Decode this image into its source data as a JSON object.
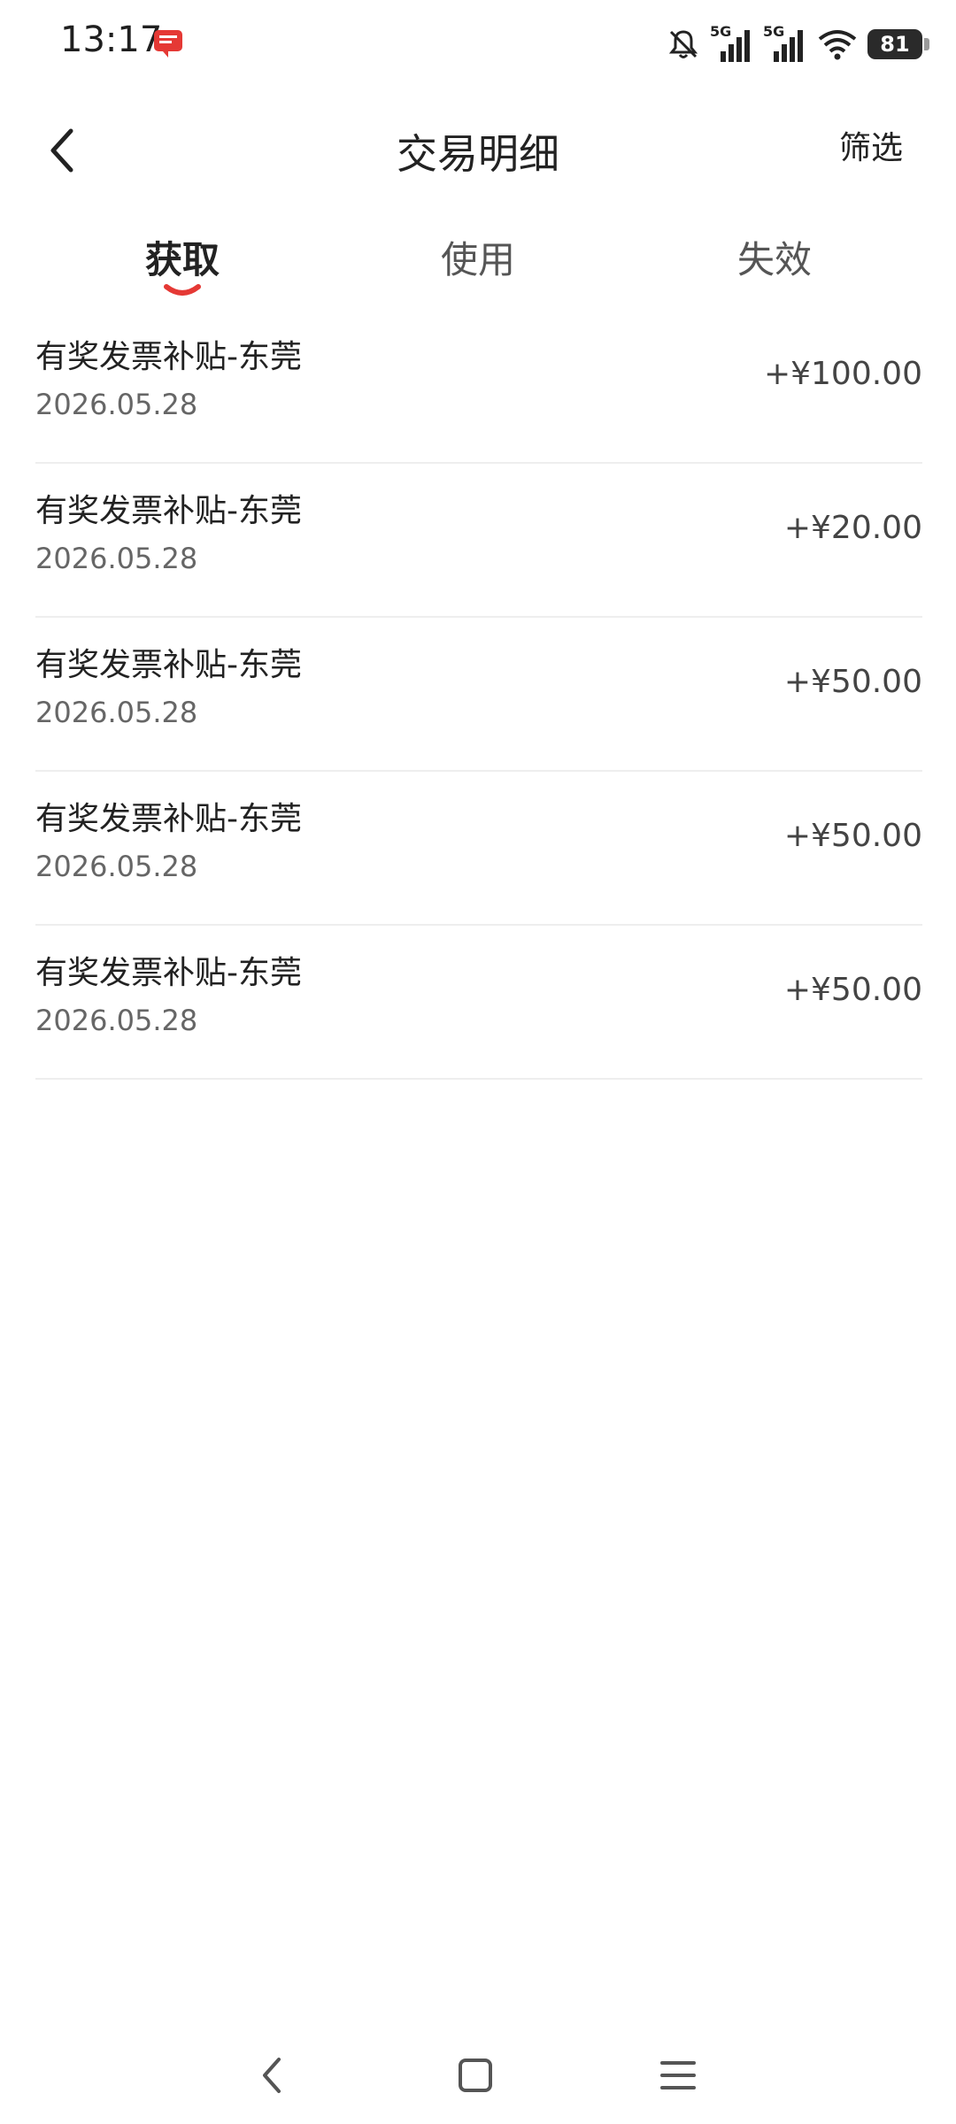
{
  "status_bar": {
    "time": "13:17",
    "network_1": "5G",
    "network_2": "5G",
    "battery_level": "81",
    "icons": [
      "notification-app-icon",
      "mute-icon",
      "signal-icon",
      "signal-icon",
      "wifi-icon",
      "battery-icon"
    ]
  },
  "header": {
    "title": "交易明细",
    "filter_label": "筛选",
    "back_icon": "chevron-left-icon"
  },
  "tabs": [
    {
      "label": "获取",
      "active": true
    },
    {
      "label": "使用",
      "active": false
    },
    {
      "label": "失效",
      "active": false
    }
  ],
  "accent_color": "#e53935",
  "transactions": [
    {
      "title": "有奖发票补贴-东莞",
      "date": "2026.05.28",
      "amount": "+¥100.00"
    },
    {
      "title": "有奖发票补贴-东莞",
      "date": "2026.05.28",
      "amount": "+¥20.00"
    },
    {
      "title": "有奖发票补贴-东莞",
      "date": "2026.05.28",
      "amount": "+¥50.00"
    },
    {
      "title": "有奖发票补贴-东莞",
      "date": "2026.05.28",
      "amount": "+¥50.00"
    },
    {
      "title": "有奖发票补贴-东莞",
      "date": "2026.05.28",
      "amount": "+¥50.00"
    }
  ],
  "nav_bar": {
    "icons": [
      "nav-back-icon",
      "nav-home-icon",
      "nav-menu-icon"
    ]
  }
}
